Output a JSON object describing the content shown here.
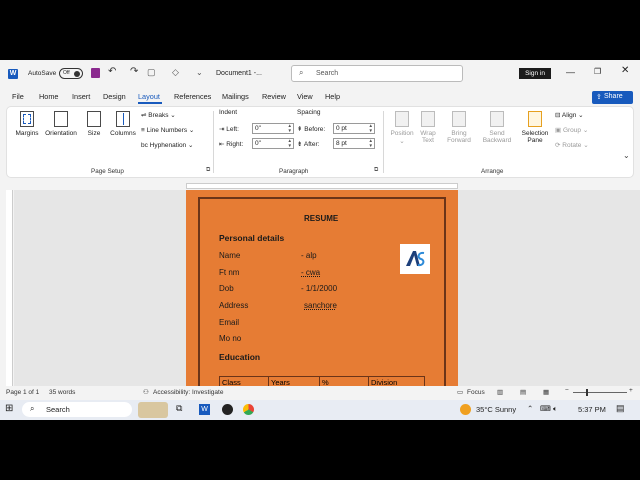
{
  "titlebar": {
    "autosave_label": "AutoSave",
    "autosave_state": "Off",
    "doc_title": "Document1 -...",
    "search_placeholder": "Search",
    "signin_label": "Sign in"
  },
  "tabs": [
    "File",
    "Home",
    "Insert",
    "Design",
    "Layout",
    "References",
    "Mailings",
    "Review",
    "View",
    "Help"
  ],
  "active_tab": "Layout",
  "share_label": "Share",
  "ribbon": {
    "page_setup": {
      "margins": "Margins",
      "orientation": "Orientation",
      "size": "Size",
      "columns": "Columns",
      "breaks": "Breaks",
      "line_numbers": "Line Numbers",
      "hyphenation": "Hyphenation",
      "group_label": "Page Setup"
    },
    "paragraph": {
      "indent_label": "Indent",
      "spacing_label": "Spacing",
      "left_label": "Left:",
      "left_value": "0\"",
      "right_label": "Right:",
      "right_value": "0\"",
      "before_label": "Before:",
      "before_value": "0 pt",
      "after_label": "After:",
      "after_value": "8 pt",
      "group_label": "Paragraph"
    },
    "arrange": {
      "position": "Position",
      "wrap_text": "Wrap Text",
      "bring_forward": "Bring Forward",
      "send_backward": "Send Backward",
      "selection_pane": "Selection Pane",
      "align": "Align",
      "group": "Group",
      "rotate": "Rotate",
      "group_label": "Arrange"
    }
  },
  "document": {
    "title": "RESUME",
    "personal_heading": "Personal details",
    "fields": [
      {
        "label": "Name",
        "value": "- alp"
      },
      {
        "label": "Ft nm",
        "value": "- cwa"
      },
      {
        "label": "Dob",
        "value": "- 1/1/2000"
      },
      {
        "label": "Address",
        "value": "sanchore"
      },
      {
        "label": "Email",
        "value": ""
      },
      {
        "label": "Mo no",
        "value": ""
      }
    ],
    "education_heading": "Education",
    "table_headers": [
      "Class",
      "Years",
      "%",
      "Division"
    ],
    "logo_text": "AS"
  },
  "statusbar": {
    "page": "Page 1 of 1",
    "words": "35 words",
    "accessibility": "Accessibility: Investigate",
    "focus": "Focus"
  },
  "taskbar": {
    "search": "Search",
    "weather": "35°C  Sunny",
    "time": "5:37 PM"
  },
  "colors": {
    "accent": "#185abd",
    "page_fill": "#e67c34",
    "page_border": "#6b3418"
  }
}
